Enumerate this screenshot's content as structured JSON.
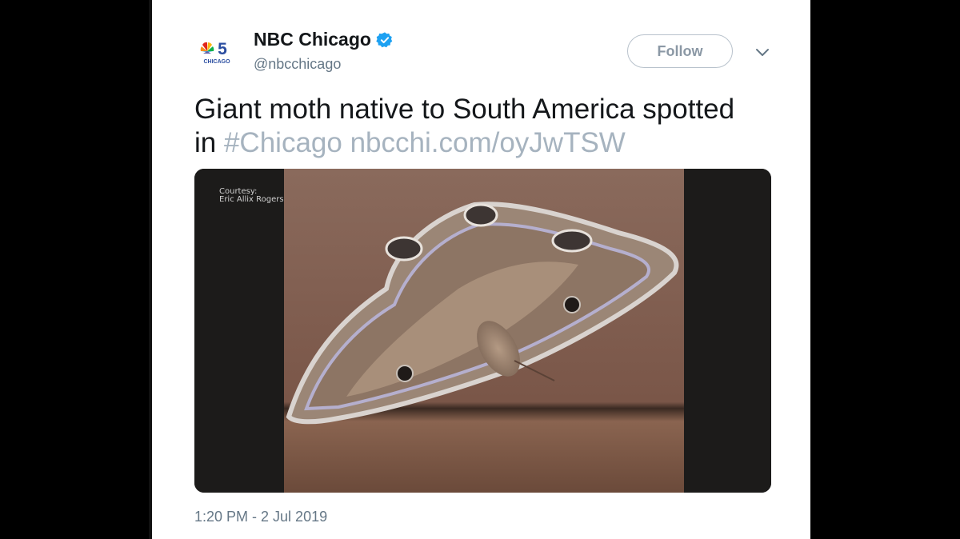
{
  "account": {
    "name": "NBC Chicago",
    "handle": "@nbcchicago",
    "verified": true,
    "logo_text": "CHICAGO",
    "logo_number": "5"
  },
  "follow": {
    "label": "Follow"
  },
  "tweet": {
    "text_line1": "Giant moth native to South America spotted",
    "text_line2_prefix": "in ",
    "hashtag": "#Chicago",
    "link": "nbcchi.com/oyJwTSW"
  },
  "media": {
    "courtesy_line1": "Courtesy:",
    "courtesy_line2": "Eric Allix Rogers"
  },
  "timestamp": "1:20 PM - 2 Jul 2019",
  "colors": {
    "verified_blue": "#1da1f2",
    "link_gray": "#a6b3bf",
    "text": "#14171a",
    "secondary": "#657786"
  },
  "icons": {
    "verified": "verified-badge-icon",
    "caret": "chevron-down-icon"
  }
}
